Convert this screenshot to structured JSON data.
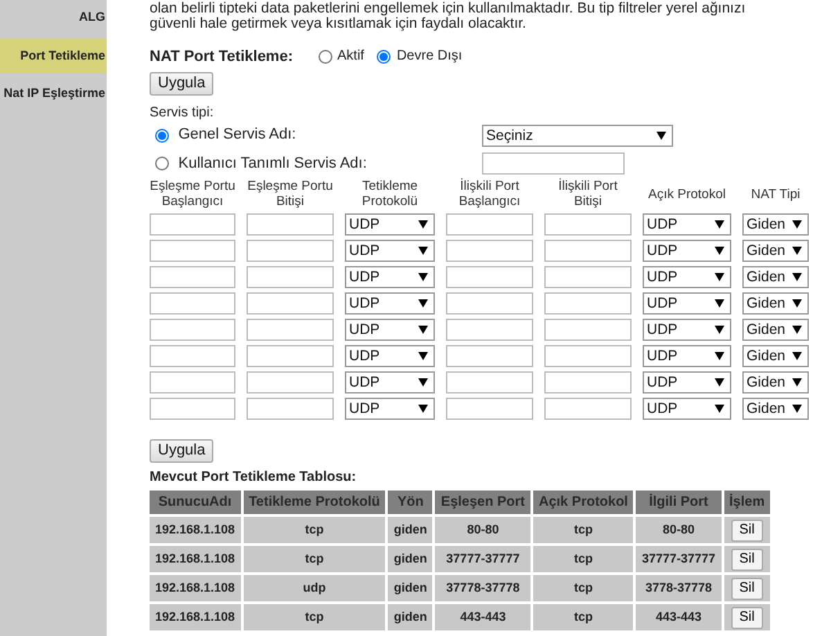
{
  "sidebar": {
    "items": [
      {
        "label": "ALG",
        "selected": false
      },
      {
        "label": "Port Tetikleme",
        "selected": true
      },
      {
        "label": "Nat IP Eşleştirme",
        "selected": false
      }
    ]
  },
  "intro_text": "olan belirli tipteki data paketlerini engellemek için kullanılmaktadır. Bu tip filtreler yerel ağınızı güvenli hale getirmek veya kısıtlamak için faydalı olacaktır.",
  "nat_port_trigger": {
    "label": "NAT Port Tetikleme:",
    "options": [
      {
        "label": "Aktif",
        "selected": false
      },
      {
        "label": "Devre Dışı",
        "selected": true
      }
    ]
  },
  "apply_button": "Uygula",
  "service_type": {
    "label": "Servis tipi:",
    "options": [
      {
        "label": "Genel Servis Adı:",
        "selected": true,
        "kind": "select",
        "value": "Seçiniz"
      },
      {
        "label": "Kullanıcı Tanımlı Servis Adı:",
        "selected": false,
        "kind": "input"
      }
    ]
  },
  "rule_grid": {
    "columns": [
      "Eşleşme Portu Başlangıcı",
      "Eşleşme Portu Bitişi",
      "Tetikleme Protokolü",
      "İlişkili Port Başlangıcı",
      "İlişkili Port Bitişi",
      "Açık Protokol",
      "NAT Tipi"
    ],
    "rows": [
      {
        "trigger_protocol": "UDP",
        "open_protocol": "UDP",
        "nat_type": "Giden"
      },
      {
        "trigger_protocol": "UDP",
        "open_protocol": "UDP",
        "nat_type": "Giden"
      },
      {
        "trigger_protocol": "UDP",
        "open_protocol": "UDP",
        "nat_type": "Giden"
      },
      {
        "trigger_protocol": "UDP",
        "open_protocol": "UDP",
        "nat_type": "Giden"
      },
      {
        "trigger_protocol": "UDP",
        "open_protocol": "UDP",
        "nat_type": "Giden"
      },
      {
        "trigger_protocol": "UDP",
        "open_protocol": "UDP",
        "nat_type": "Giden"
      },
      {
        "trigger_protocol": "UDP",
        "open_protocol": "UDP",
        "nat_type": "Giden"
      },
      {
        "trigger_protocol": "UDP",
        "open_protocol": "UDP",
        "nat_type": "Giden"
      }
    ]
  },
  "apply_button_2": "Uygula",
  "existing_table": {
    "title": "Mevcut Port Tetikleme Tablosu:",
    "columns": [
      "SunucuAdı",
      "Tetikleme Protokolü",
      "Yön",
      "Eşleşen Port",
      "Açık Protokol",
      "İlgili Port",
      "İşlem"
    ],
    "rows": [
      {
        "cells": [
          "192.168.1.108",
          "tcp",
          "giden",
          "80-80",
          "tcp",
          "80-80"
        ],
        "action": "Sil"
      },
      {
        "cells": [
          "192.168.1.108",
          "tcp",
          "giden",
          "37777-37777",
          "tcp",
          "37777-37777"
        ],
        "action": "Sil"
      },
      {
        "cells": [
          "192.168.1.108",
          "udp",
          "giden",
          "37778-37778",
          "tcp",
          "3778-37778"
        ],
        "action": "Sil"
      },
      {
        "cells": [
          "192.168.1.108",
          "tcp",
          "giden",
          "443-443",
          "tcp",
          "443-443"
        ],
        "action": "Sil"
      }
    ]
  }
}
